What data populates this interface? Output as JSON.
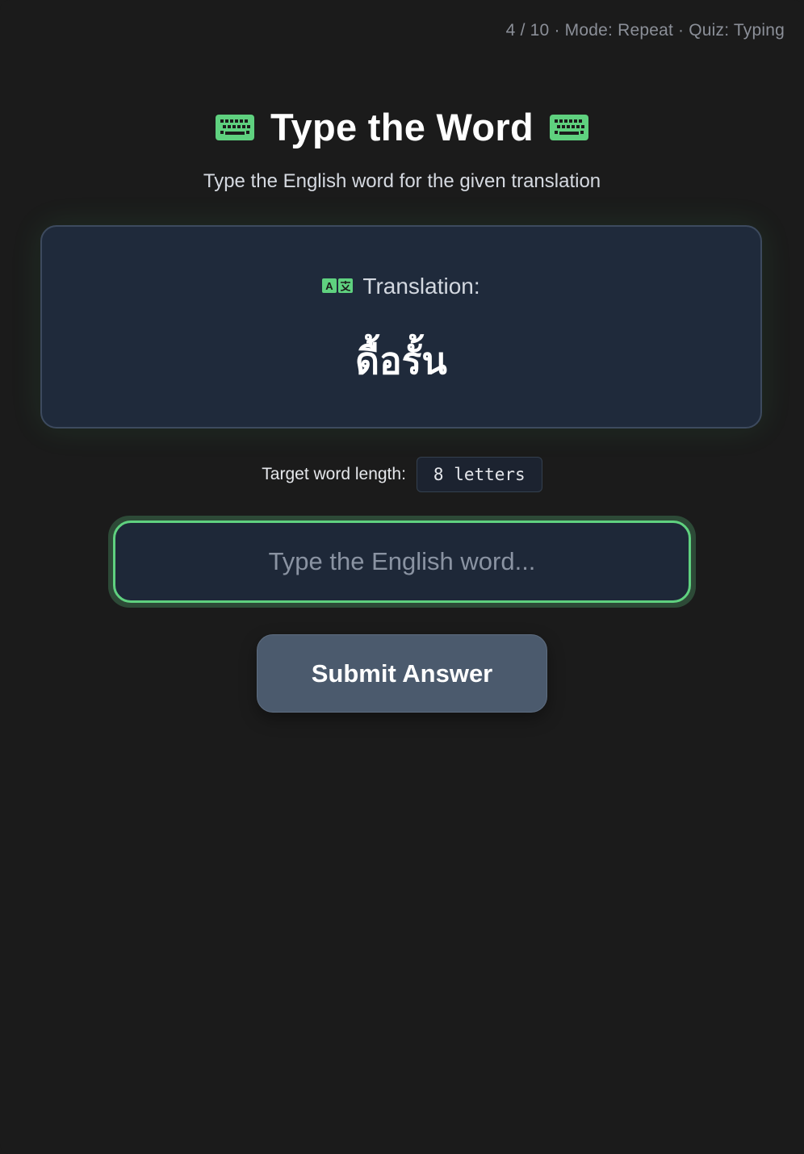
{
  "header": {
    "status": "4 / 10 · Mode: Repeat · Quiz: Typing"
  },
  "main": {
    "title": "Type the Word",
    "title_icon": "keyboard-icon",
    "subtitle": "Type the English word for the given translation"
  },
  "card": {
    "label_icon": "translate-icon",
    "label": "Translation:",
    "word": "ดื้อรั้น"
  },
  "hint": {
    "label": "Target word length:",
    "value": "8 letters"
  },
  "answer": {
    "value": "",
    "placeholder": "Type the English word..."
  },
  "actions": {
    "submit_label": "Submit Answer"
  },
  "colors": {
    "accent": "#5fd17f",
    "background": "#1b1b1b",
    "card": "#1f2a3b",
    "button": "#4b5a6d"
  }
}
